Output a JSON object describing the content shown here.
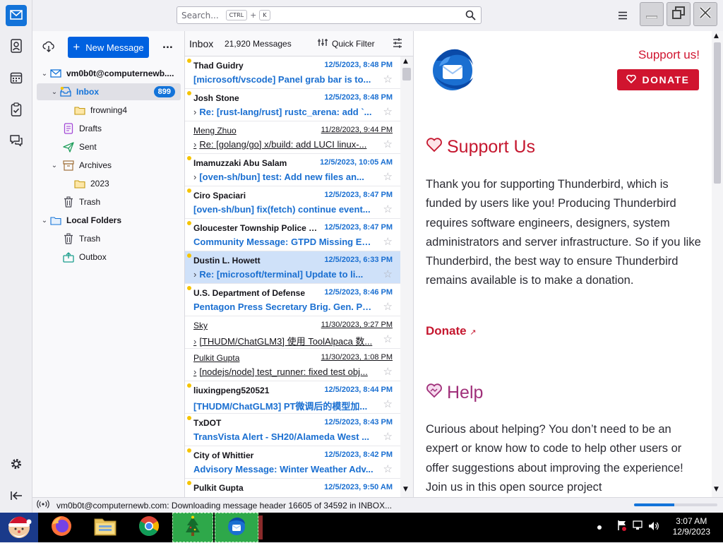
{
  "search": {
    "placeholder": "Search...",
    "key1": "CTRL",
    "plus": "+",
    "key2": "K"
  },
  "folder_pane": {
    "new_message": "New Message",
    "more": "...",
    "account": "vm0b0t@computernewb....",
    "folders": [
      {
        "label": "Inbox",
        "badge": "899"
      },
      {
        "label": "frowning4"
      },
      {
        "label": "Drafts"
      },
      {
        "label": "Sent"
      },
      {
        "label": "Archives"
      },
      {
        "label": "2023"
      },
      {
        "label": "Trash"
      },
      {
        "label": "Local Folders"
      },
      {
        "label": "Trash"
      },
      {
        "label": "Outbox"
      }
    ]
  },
  "thread_pane": {
    "folder": "Inbox",
    "count": "21,920 Messages",
    "quick_filter": "Quick Filter",
    "messages": [
      {
        "sender": "Thad Guidry",
        "date": "12/5/2023, 8:48 PM",
        "subject": "[microsoft/vscode] Panel grab bar is to...",
        "thread": false,
        "unread": true
      },
      {
        "sender": "Josh Stone",
        "date": "12/5/2023, 8:48 PM",
        "subject": "Re: [rust-lang/rust] rustc_arena: add `...",
        "thread": true,
        "unread": true
      },
      {
        "sender": "Meng Zhuo",
        "date": "11/28/2023, 9:44 PM",
        "subject": "Re: [golang/go] x/build: add LUCI linux-...",
        "thread": true,
        "unread": false
      },
      {
        "sender": "Imamuzzaki Abu Salam",
        "date": "12/5/2023, 10:05 AM",
        "subject": "[oven-sh/bun] test: Add new files an...",
        "thread": true,
        "unread": true
      },
      {
        "sender": "Ciro Spaciari",
        "date": "12/5/2023, 8:47 PM",
        "subject": "[oven-sh/bun] fix(fetch) continue event...",
        "thread": false,
        "unread": true
      },
      {
        "sender": "Gloucester Township Police D...",
        "date": "12/5/2023, 8:47 PM",
        "subject": "Community Message: GTPD Missing En...",
        "thread": false,
        "unread": true
      },
      {
        "sender": "Dustin L. Howett",
        "date": "12/5/2023, 6:33 PM",
        "subject": "Re: [microsoft/terminal] Update to li...",
        "thread": true,
        "unread": true,
        "selected": true
      },
      {
        "sender": "U.S. Department of Defense",
        "date": "12/5/2023, 8:46 PM",
        "subject": "Pentagon Press Secretary Brig. Gen. Pat...",
        "thread": false,
        "unread": true
      },
      {
        "sender": "Sky",
        "date": "11/30/2023, 9:27 PM",
        "subject": "[THUDM/ChatGLM3] 使用 ToolAlpaca 数...",
        "thread": true,
        "unread": false
      },
      {
        "sender": "Pulkit Gupta",
        "date": "11/30/2023, 1:08 PM",
        "subject": "[nodejs/node] test_runner: fixed test obj...",
        "thread": true,
        "unread": false
      },
      {
        "sender": "liuxingpeng520521",
        "date": "12/5/2023, 8:44 PM",
        "subject": "[THUDM/ChatGLM3] PT微调后的模型加...",
        "thread": false,
        "unread": true
      },
      {
        "sender": "TxDOT",
        "date": "12/5/2023, 8:43 PM",
        "subject": "TransVista Alert - SH20/Alameda West ...",
        "thread": false,
        "unread": true
      },
      {
        "sender": "City of Whittier",
        "date": "12/5/2023, 8:42 PM",
        "subject": "Advisory Message: Winter Weather Adv...",
        "thread": false,
        "unread": true
      },
      {
        "sender": "Pulkit Gupta",
        "date": "12/5/2023, 9:50 AM",
        "subject": "",
        "thread": false,
        "unread": true
      }
    ]
  },
  "reader": {
    "support_link": "Support us!",
    "donate_button": "DONATE",
    "support_heading": "Support Us",
    "support_text": "Thank you for supporting Thunderbird, which is funded by users like you! Producing Thunderbird requires software engineers, designers, system administrators and server infrastructure. So if you like Thunderbird, the best way to ensure Thunderbird remains available is to make a donation.",
    "donate_link": "Donate",
    "help_heading": "Help",
    "help_text": "Curious about helping? You don’t need to be an expert or know how to code to help other users or offer suggestions about improving the experience! Join us in this open source project"
  },
  "status": {
    "text": "vm0b0t@computernewb.com: Downloading message header 16605 of 34592 in INBOX...",
    "progress": 0.48
  },
  "taskbar": {
    "time": "3:07 AM",
    "date": "12/9/2023"
  },
  "colors": {
    "accent": "#0061e0",
    "unread": "#1a6fd1",
    "brand_red": "#c5172f"
  }
}
